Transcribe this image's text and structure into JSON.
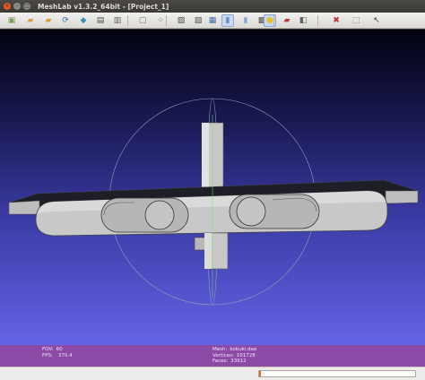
{
  "window": {
    "title": "MeshLab v1.3.2_64bit - [Project_1]",
    "close_glyph": "×",
    "minimize_glyph": "–",
    "maximize_glyph": "□"
  },
  "toolbar": {
    "buttons": [
      {
        "name": "open-project-icon",
        "glyph": "▣",
        "color": "#7a9a5a",
        "active": false
      },
      {
        "name": "import-mesh-icon",
        "glyph": "▰",
        "color": "#d4a13a",
        "active": false
      },
      {
        "name": "save-project-icon",
        "glyph": "▰",
        "color": "#d4a13a",
        "active": false
      },
      {
        "name": "reload-icon",
        "glyph": "⟳",
        "color": "#3a6fb0",
        "active": false
      },
      {
        "name": "export-mesh-icon",
        "glyph": "◆",
        "color": "#3a8fb0",
        "active": false
      },
      {
        "name": "snapshot-icon",
        "glyph": "▤",
        "color": "#505050",
        "active": false
      },
      {
        "name": "layers-icon",
        "glyph": "▥",
        "color": "#606060",
        "active": false
      },
      {
        "name": "bounding-box-icon",
        "glyph": "▢",
        "color": "#707070",
        "active": false
      },
      {
        "name": "points-icon",
        "glyph": "⁘",
        "color": "#505050",
        "active": false
      },
      {
        "name": "wireframe-icon",
        "glyph": "▨",
        "color": "#505050",
        "active": false
      },
      {
        "name": "hidden-lines-icon",
        "glyph": "▧",
        "color": "#505050",
        "active": false
      },
      {
        "name": "flat-lines-icon",
        "glyph": "▦",
        "color": "#3a6fb0",
        "active": false
      },
      {
        "name": "flat-shading-icon",
        "glyph": "▮",
        "color": "#6a8fc0",
        "active": true
      },
      {
        "name": "smooth-shading-icon",
        "glyph": "▮",
        "color": "#8aa8d0",
        "active": false
      },
      {
        "name": "texture-icon",
        "glyph": "▩",
        "color": "#505050",
        "active": false
      },
      {
        "name": "lighting-icon",
        "glyph": "●",
        "color": "#e8c020",
        "active": true
      },
      {
        "name": "color-icon",
        "glyph": "▰",
        "color": "#c03a3a",
        "active": false
      },
      {
        "name": "backface-icon",
        "glyph": "◧",
        "color": "#606060",
        "active": false
      },
      {
        "name": "delete-icon",
        "glyph": "✖",
        "color": "#c03030",
        "active": false
      },
      {
        "name": "select-faces-icon",
        "glyph": "⬚",
        "color": "#606060",
        "active": false
      },
      {
        "name": "select-vertices-icon",
        "glyph": "↖",
        "color": "#404040",
        "active": false
      }
    ]
  },
  "info": {
    "fov_label": "FOV:",
    "fov_value": "60",
    "fps_label": "FPS:",
    "fps_value": "370.4",
    "mesh_label": "Mesh:",
    "mesh_value": "kobuki.dae",
    "vertices_label": "Vertices:",
    "vertices_value": "101728",
    "faces_label": "Faces:",
    "faces_value": "33912"
  },
  "status": {
    "progress_fraction": 0.01
  },
  "colors": {
    "viewport_top": "#020210",
    "viewport_bottom": "#6464e6",
    "info_panel": "#8a4aa6",
    "mesh": "#c8c8c8"
  }
}
